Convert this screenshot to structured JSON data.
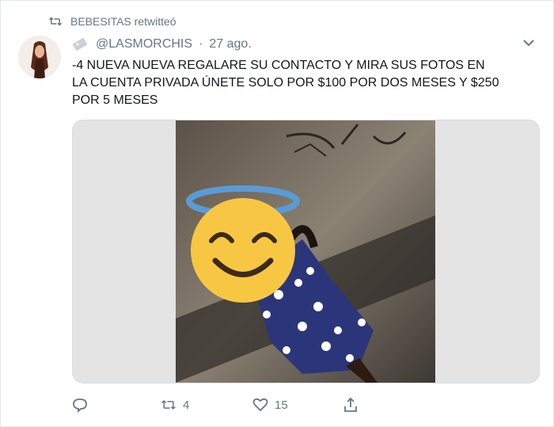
{
  "retweet": {
    "icon": "retweet-icon",
    "text": "BEBESITAS retwitteó"
  },
  "tweet": {
    "avatar_icon": "avatar-photo",
    "badge_icon": "tag-icon",
    "handle": "@LASMORCHIS",
    "separator": "·",
    "time": "27 ago.",
    "text": "-4 NUEVA NUEVA REGALARE SU CONTACTO Y MIRA SUS FOTOS EN\nLA CUENTA PRIVADA ÚNETE SOLO POR $100 POR DOS MESES Y $250\nPOR 5 MESES",
    "media_overlay_icon": "smiling-face-with-halo-emoji"
  },
  "actions": {
    "reply_icon": "reply-icon",
    "retweet_icon": "retweet-icon",
    "retweet_count": "4",
    "like_icon": "heart-icon",
    "like_count": "15",
    "share_icon": "share-icon"
  },
  "colors": {
    "secondary_text": "#657786",
    "primary_text": "#14171a",
    "border": "#e1e8ed",
    "halo": "#5b9bd5",
    "emoji": "#f7c744"
  }
}
